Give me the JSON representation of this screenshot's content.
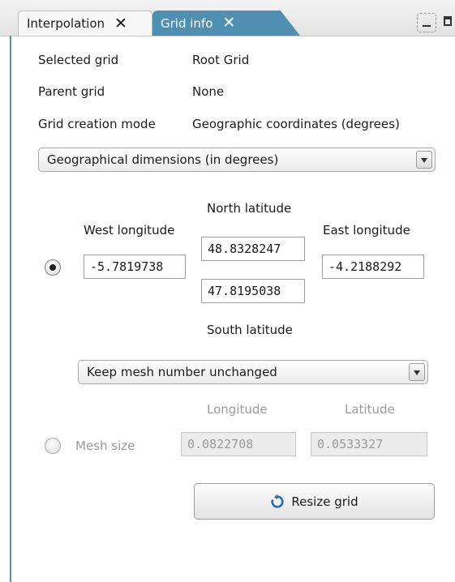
{
  "tabs": [
    {
      "label": "Interpolation",
      "active": false
    },
    {
      "label": "Grid info",
      "active": true
    }
  ],
  "info": {
    "selected_grid": {
      "label": "Selected grid",
      "value": "Root Grid"
    },
    "parent_grid": {
      "label": "Parent grid",
      "value": "None"
    },
    "creation_mode": {
      "label": "Grid creation mode",
      "value": "Geographic coordinates (degrees)"
    }
  },
  "dimensions_select": {
    "value": "Geographical dimensions (in degrees)"
  },
  "bounds": {
    "north": {
      "label": "North latitude",
      "value": "48.8328247"
    },
    "south": {
      "label": "South latitude",
      "value": "47.8195038"
    },
    "west": {
      "label": "West longitude",
      "value": "-5.7819738"
    },
    "east": {
      "label": "East longitude",
      "value": "-4.2188292"
    },
    "selected": true
  },
  "mesh_select": {
    "value": "Keep mesh number unchanged"
  },
  "mesh_size": {
    "label": "Mesh size",
    "longitude_label": "Longitude",
    "latitude_label": "Latitude",
    "longitude": "0.0822708",
    "latitude": "0.0533327",
    "selected": false
  },
  "resize_button": {
    "label": "Resize grid",
    "icon": "refresh-icon"
  },
  "colors": {
    "accent": "#4f8fb2",
    "refresh_icon": "#2a6fb0"
  }
}
